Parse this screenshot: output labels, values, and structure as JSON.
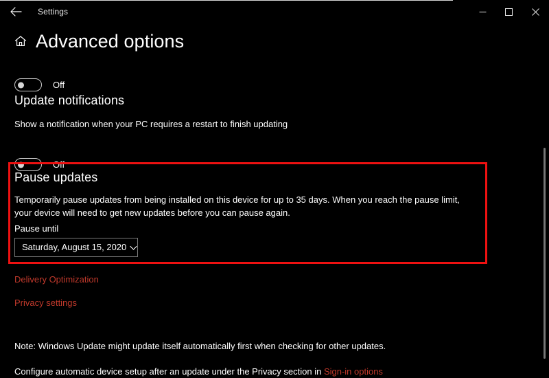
{
  "window": {
    "title": "Settings",
    "back_icon": "back-arrow-icon",
    "controls": {
      "minimize": "minimize-icon",
      "maximize": "maximize-icon",
      "close": "close-icon"
    }
  },
  "page": {
    "home_icon": "home-icon",
    "title": "Advanced options"
  },
  "advanced_options_toggle": {
    "state_label": "Off",
    "checked": false
  },
  "update_notifications": {
    "heading": "Update notifications",
    "description": "Show a notification when your PC requires a restart to finish updating",
    "toggle": {
      "state_label": "Off",
      "checked": false
    }
  },
  "pause_updates": {
    "heading": "Pause updates",
    "description": "Temporarily pause updates from being installed on this device for up to 35 days. When you reach the pause limit, your device will need to get new updates before you can pause again.",
    "pause_until_label": "Pause until",
    "pause_until_value": "Saturday, August 15, 2020",
    "chevron_icon": "chevron-down-icon",
    "highlight_color": "#ee1111"
  },
  "links": {
    "delivery_optimization": "Delivery Optimization",
    "privacy_settings": "Privacy settings",
    "accent_color": "#c0392b"
  },
  "notes": {
    "windows_update_note": "Note: Windows Update might update itself automatically first when checking for other updates.",
    "configure_prefix": "Configure automatic device setup after an update under the Privacy section in ",
    "configure_link": "Sign-in options"
  }
}
